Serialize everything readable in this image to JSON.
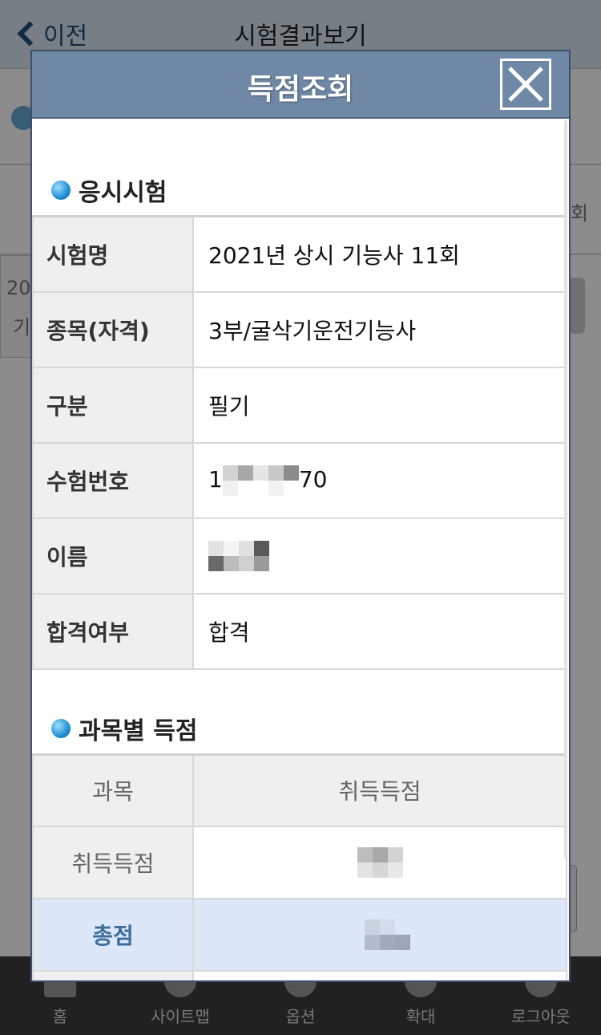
{
  "background": {
    "back_label": "이전",
    "title": "시험결과보기",
    "side_text_1": "20",
    "side_text_2": "기",
    "side_text_3": "회"
  },
  "footer": {
    "items": [
      {
        "label": "홈",
        "icon": "home-icon"
      },
      {
        "label": "사이트맵",
        "icon": "globe-icon"
      },
      {
        "label": "옵션",
        "icon": "gear-icon"
      },
      {
        "label": "확대",
        "icon": "zoom-icon"
      },
      {
        "label": "로그아웃",
        "icon": "logout-icon"
      }
    ]
  },
  "modal": {
    "title": "득점조회",
    "close_icon": "close-icon",
    "sections": {
      "exam": {
        "title": "응시시험",
        "rows": [
          {
            "label": "시험명",
            "value": "2021년 상시 기능사 11회"
          },
          {
            "label": "종목(자격)",
            "value": "3부/굴삭기운전기능사"
          },
          {
            "label": "구분",
            "value": "필기"
          },
          {
            "label": "수험번호",
            "value_prefix": "1",
            "value_suffix": "70"
          },
          {
            "label": "이름",
            "value": ""
          },
          {
            "label": "합격여부",
            "value": "합격"
          }
        ]
      },
      "scores": {
        "title": "과목별 득점",
        "header": {
          "subject": "과목",
          "score": "취득득점"
        },
        "rows": [
          {
            "subject": "취득득점",
            "score": ""
          }
        ],
        "total": {
          "label": "총점",
          "score": ""
        }
      }
    }
  },
  "colors": {
    "modal_header": "#6f88a6",
    "section_dot": "#1f8fd6",
    "total_row": "#dce7f8",
    "total_label": "#3c6e9c"
  }
}
